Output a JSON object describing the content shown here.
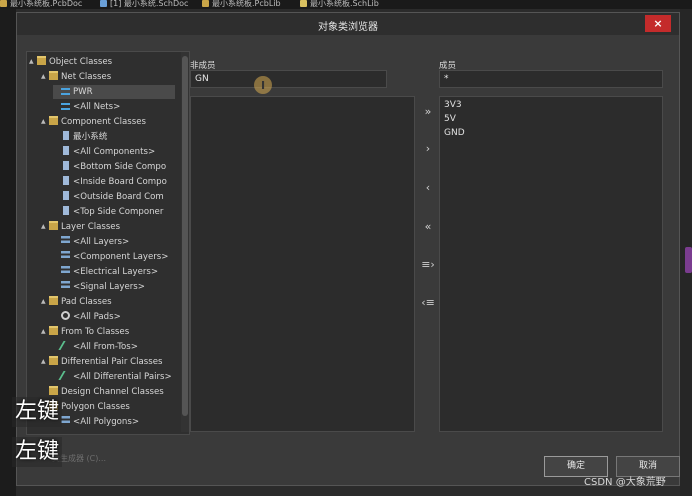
{
  "doc_tabs": [
    {
      "label": "最小系统板.PcbDoc",
      "color": "#c9a548"
    },
    {
      "label": "[1] 最小系统.SchDoc",
      "color": "#6aa0d8"
    },
    {
      "label": "最小系统板.PcbLib",
      "color": "#c9a548"
    },
    {
      "label": "最小系统板.SchLib",
      "color": "#d8c060"
    }
  ],
  "dialog": {
    "title": "对象类浏览器",
    "close_label": "×"
  },
  "tree": [
    {
      "label": "Object Classes",
      "indent": 0,
      "arrow": "▲",
      "icon": "folder-icon"
    },
    {
      "label": "Net Classes",
      "indent": 1,
      "arrow": "▲",
      "icon": "folder-icon"
    },
    {
      "label": "PWR",
      "indent": 2,
      "arrow": "",
      "icon": "net-icon",
      "selected": true
    },
    {
      "label": "<All Nets>",
      "indent": 2,
      "arrow": "",
      "icon": "net-icon"
    },
    {
      "label": "Component Classes",
      "indent": 1,
      "arrow": "▲",
      "icon": "folder-icon"
    },
    {
      "label": "最小系统",
      "indent": 2,
      "arrow": "",
      "icon": "component-icon"
    },
    {
      "label": "<All Components>",
      "indent": 2,
      "arrow": "",
      "icon": "component-icon"
    },
    {
      "label": "<Bottom Side Compo",
      "indent": 2,
      "arrow": "",
      "icon": "component-icon"
    },
    {
      "label": "<Inside Board Compo",
      "indent": 2,
      "arrow": "",
      "icon": "component-icon"
    },
    {
      "label": "<Outside Board Com",
      "indent": 2,
      "arrow": "",
      "icon": "component-icon"
    },
    {
      "label": "<Top Side Componer",
      "indent": 2,
      "arrow": "",
      "icon": "component-icon"
    },
    {
      "label": "Layer Classes",
      "indent": 1,
      "arrow": "▲",
      "icon": "folder-icon"
    },
    {
      "label": "<All Layers>",
      "indent": 2,
      "arrow": "",
      "icon": "layer-icon"
    },
    {
      "label": "<Component Layers>",
      "indent": 2,
      "arrow": "",
      "icon": "layer-icon"
    },
    {
      "label": "<Electrical Layers>",
      "indent": 2,
      "arrow": "",
      "icon": "layer-icon"
    },
    {
      "label": "<Signal Layers>",
      "indent": 2,
      "arrow": "",
      "icon": "layer-icon"
    },
    {
      "label": "Pad Classes",
      "indent": 1,
      "arrow": "▲",
      "icon": "folder-icon"
    },
    {
      "label": "<All Pads>",
      "indent": 2,
      "arrow": "",
      "icon": "pad-icon"
    },
    {
      "label": "From To Classes",
      "indent": 1,
      "arrow": "▲",
      "icon": "folder-icon"
    },
    {
      "label": "<All From-Tos>",
      "indent": 2,
      "arrow": "",
      "icon": "from-to-icon"
    },
    {
      "label": "Differential Pair Classes",
      "indent": 1,
      "arrow": "▲",
      "icon": "folder-icon"
    },
    {
      "label": "<All Differential Pairs>",
      "indent": 2,
      "arrow": "",
      "icon": "diff-pair-icon"
    },
    {
      "label": "Design Channel Classes",
      "indent": 1,
      "arrow": "",
      "icon": "folder-icon"
    },
    {
      "label": "Polygon Classes",
      "indent": 1,
      "arrow": "▲",
      "icon": "folder-icon"
    },
    {
      "label": "<All Polygons>",
      "indent": 2,
      "arrow": "",
      "icon": "polygon-icon"
    }
  ],
  "captions": [
    "左键",
    "左键"
  ],
  "non_members": {
    "label": "非成员",
    "filter_value": "GN",
    "items": []
  },
  "members": {
    "label": "成员",
    "filter_value": "*",
    "items": [
      "3V3",
      "5V",
      "GND"
    ]
  },
  "move_buttons": [
    {
      "name": "add-all-button",
      "glyph": "»"
    },
    {
      "name": "add-button",
      "glyph": "›"
    },
    {
      "name": "remove-button",
      "glyph": "‹"
    },
    {
      "name": "remove-all-button",
      "glyph": "«"
    },
    {
      "name": "add-selected-button",
      "glyph": "≡›"
    },
    {
      "name": "remove-selected-button",
      "glyph": "‹≡"
    }
  ],
  "footer_text": "类生成器 (C)...",
  "ok_label": "确定",
  "cancel_label": "取消",
  "watermark": "CSDN @大象荒野"
}
